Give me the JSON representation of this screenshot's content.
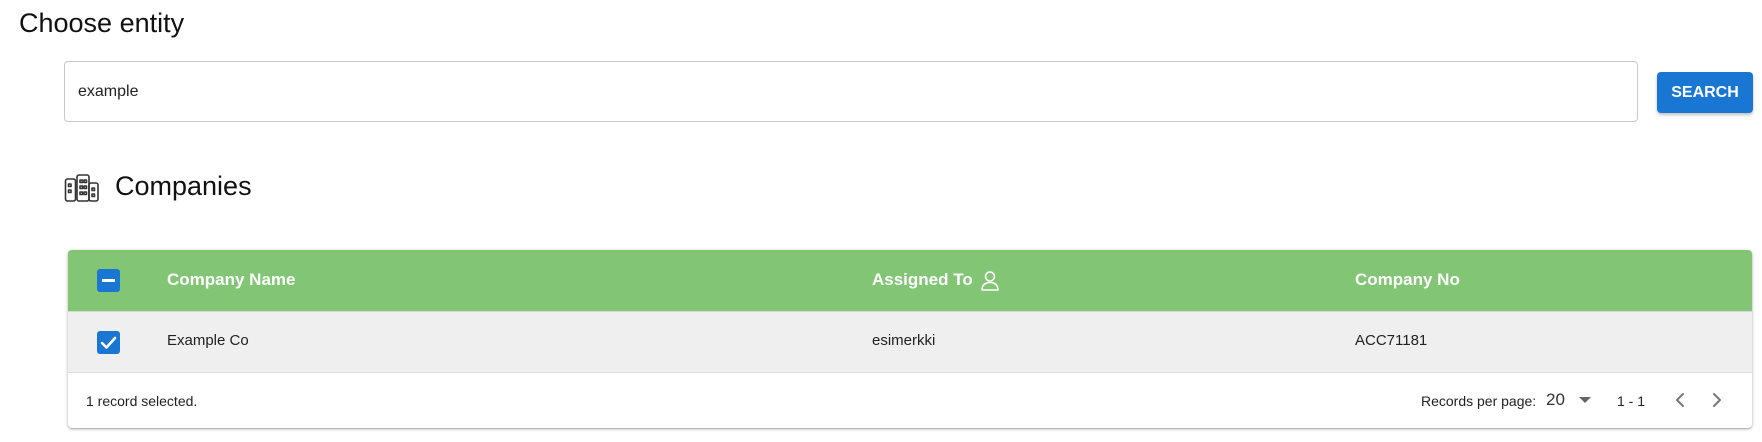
{
  "page": {
    "title": "Choose entity"
  },
  "search": {
    "value": "example",
    "button_label": "SEARCH"
  },
  "section": {
    "title": "Companies",
    "icon": "buildings-icon"
  },
  "table": {
    "header_color": "#82c675",
    "accent_color": "#1976d2",
    "columns": [
      {
        "label": "Company Name"
      },
      {
        "label": "Assigned To",
        "icon": "person-icon"
      },
      {
        "label": "Company No"
      }
    ],
    "rows": [
      {
        "selected": true,
        "company_name": "Example Co",
        "assigned_to": "esimerkki",
        "company_no": "ACC71181"
      }
    ],
    "select_all_state": "indeterminate"
  },
  "footer": {
    "selected_text": "1 record selected.",
    "rows_per_page_label": "Records per page:",
    "rows_per_page_value": "20",
    "range_text": "1 - 1"
  }
}
